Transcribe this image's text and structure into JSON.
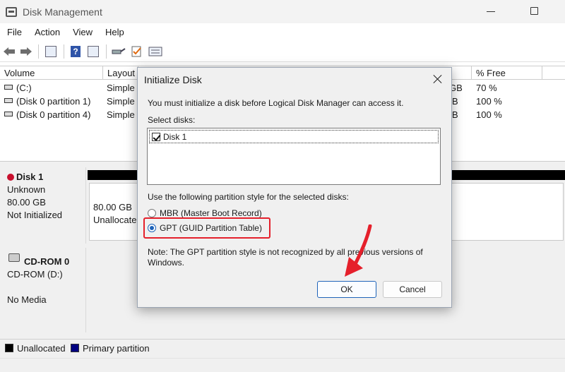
{
  "window": {
    "title": "Disk Management"
  },
  "menu": [
    "File",
    "Action",
    "View",
    "Help"
  ],
  "toolbar": {
    "icons": [
      "back-icon",
      "forward-icon",
      "console-tree-icon",
      "help-icon",
      "properties-icon",
      "connect-icon",
      "check-icon",
      "list-icon"
    ]
  },
  "volume_list": {
    "columns": [
      "Volume",
      "Layout",
      "p...",
      "% Free"
    ],
    "rows": [
      {
        "name": "(C:)",
        "layout": "Simple",
        "capacity_fragment": "GB",
        "free": "70 %"
      },
      {
        "name": "(Disk 0 partition 1)",
        "layout": "Simple",
        "capacity_fragment": "B",
        "free": "100 %"
      },
      {
        "name": "(Disk 0 partition 4)",
        "layout": "Simple",
        "capacity_fragment": "B",
        "free": "100 %"
      }
    ]
  },
  "disks": [
    {
      "name": "Disk 1",
      "type": "Unknown",
      "size": "80.00 GB",
      "status": "Not Initialized",
      "partition_size": "80.00 GB",
      "partition_state": "Unallocate"
    },
    {
      "name": "CD-ROM 0",
      "type": "CD-ROM (D:)",
      "status": "No Media"
    }
  ],
  "legend": [
    {
      "label": "Unallocated",
      "color": "#000000"
    },
    {
      "label": "Primary partition",
      "color": "#000080"
    }
  ],
  "dialog": {
    "title": "Initialize Disk",
    "intro": "You must initialize a disk before Logical Disk Manager can access it.",
    "select_label": "Select disks:",
    "disks": [
      {
        "label": "Disk 1",
        "checked": true
      }
    ],
    "style_label": "Use the following partition style for the selected disks:",
    "options": [
      {
        "label": "MBR (Master Boot Record)",
        "selected": false
      },
      {
        "label": "GPT (GUID Partition Table)",
        "selected": true
      }
    ],
    "note_line1": "Note: The GPT partition style is not recognized by all previous versions of",
    "note_line2": "Windows.",
    "ok_label": "OK",
    "cancel_label": "Cancel"
  },
  "colors": {
    "accent": "#1e63b9",
    "highlight": "#e5202b"
  }
}
